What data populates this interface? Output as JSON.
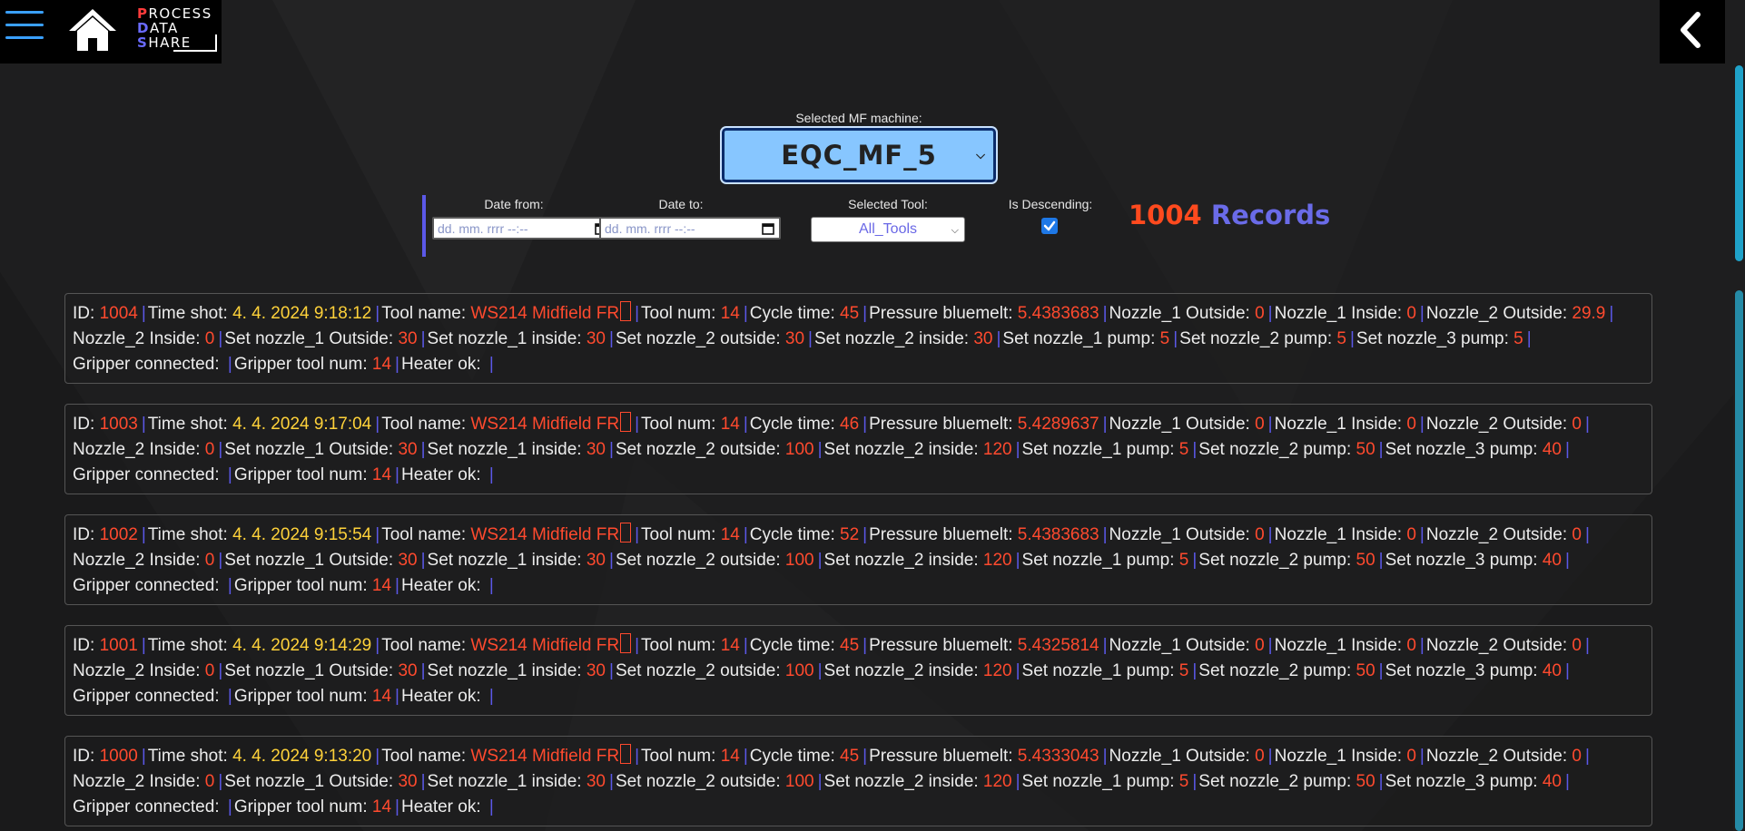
{
  "app": {
    "logo_lines": [
      {
        "first": "P",
        "rest": "ROCESS"
      },
      {
        "first": "D",
        "rest": "ATA"
      },
      {
        "first": "S",
        "rest": "HARE"
      }
    ]
  },
  "machine": {
    "label": "Selected MF machine:",
    "value": "EQC_MF_5"
  },
  "filters": {
    "date_from_label": "Date from:",
    "date_to_label": "Date to:",
    "date_placeholder": "dd. mm. rrrr --:--",
    "tool_label": "Selected Tool:",
    "tool_value": "All_Tools",
    "desc_label": "Is Descending:",
    "desc_checked": true
  },
  "records_summary": {
    "count": "1004",
    "word": "Records"
  },
  "field_labels": {
    "id": "ID:",
    "time": "Time shot:",
    "tool_name": "Tool name:",
    "tool_num": "Tool num:",
    "cycle": "Cycle time:",
    "pressure": "Pressure bluemelt:",
    "n1_out": "Nozzle_1 Outside:",
    "n1_in": "Nozzle_1 Inside:",
    "n2_out": "Nozzle_2 Outside:",
    "n2_in": "Nozzle_2 Inside:",
    "sn1_out": "Set nozzle_1 Outside:",
    "sn1_in": "Set nozzle_1 inside:",
    "sn2_out": "Set nozzle_2 outside:",
    "sn2_in": "Set nozzle_2 inside:",
    "sn1_pump": "Set nozzle_1 pump:",
    "sn2_pump": "Set nozzle_2 pump:",
    "sn3_pump": "Set nozzle_3 pump:",
    "gripper": "Gripper connected:",
    "gripper_tool": "Gripper tool num:",
    "heater": "Heater ok:"
  },
  "records": [
    {
      "id": "1004",
      "time": "4. 4. 2024 9:18:12",
      "tool_name": "WS214 Midfield FR",
      "tool_num": "14",
      "cycle": "45",
      "pressure": "5.4383683",
      "n1_out": "0",
      "n1_in": "0",
      "n2_out": "29.9",
      "n2_in": "0",
      "sn1_out": "30",
      "sn1_in": "30",
      "sn2_out": "30",
      "sn2_in": "30",
      "sn1_pump": "5",
      "sn2_pump": "5",
      "sn3_pump": "5",
      "gripper": "",
      "gripper_tool": "14",
      "heater": ""
    },
    {
      "id": "1003",
      "time": "4. 4. 2024 9:17:04",
      "tool_name": "WS214 Midfield FR",
      "tool_num": "14",
      "cycle": "46",
      "pressure": "5.4289637",
      "n1_out": "0",
      "n1_in": "0",
      "n2_out": "0",
      "n2_in": "0",
      "sn1_out": "30",
      "sn1_in": "30",
      "sn2_out": "100",
      "sn2_in": "120",
      "sn1_pump": "5",
      "sn2_pump": "50",
      "sn3_pump": "40",
      "gripper": "",
      "gripper_tool": "14",
      "heater": ""
    },
    {
      "id": "1002",
      "time": "4. 4. 2024 9:15:54",
      "tool_name": "WS214 Midfield FR",
      "tool_num": "14",
      "cycle": "52",
      "pressure": "5.4383683",
      "n1_out": "0",
      "n1_in": "0",
      "n2_out": "0",
      "n2_in": "0",
      "sn1_out": "30",
      "sn1_in": "30",
      "sn2_out": "100",
      "sn2_in": "120",
      "sn1_pump": "5",
      "sn2_pump": "50",
      "sn3_pump": "40",
      "gripper": "",
      "gripper_tool": "14",
      "heater": ""
    },
    {
      "id": "1001",
      "time": "4. 4. 2024 9:14:29",
      "tool_name": "WS214 Midfield FR",
      "tool_num": "14",
      "cycle": "45",
      "pressure": "5.4325814",
      "n1_out": "0",
      "n1_in": "0",
      "n2_out": "0",
      "n2_in": "0",
      "sn1_out": "30",
      "sn1_in": "30",
      "sn2_out": "100",
      "sn2_in": "120",
      "sn1_pump": "5",
      "sn2_pump": "50",
      "sn3_pump": "40",
      "gripper": "",
      "gripper_tool": "14",
      "heater": ""
    },
    {
      "id": "1000",
      "time": "4. 4. 2024 9:13:20",
      "tool_name": "WS214 Midfield FR",
      "tool_num": "14",
      "cycle": "45",
      "pressure": "5.4333043",
      "n1_out": "0",
      "n1_in": "0",
      "n2_out": "0",
      "n2_in": "0",
      "sn1_out": "30",
      "sn1_in": "30",
      "sn2_out": "100",
      "sn2_in": "120",
      "sn1_pump": "5",
      "sn2_pump": "50",
      "sn3_pump": "40",
      "gripper": "",
      "gripper_tool": "14",
      "heater": ""
    }
  ]
}
